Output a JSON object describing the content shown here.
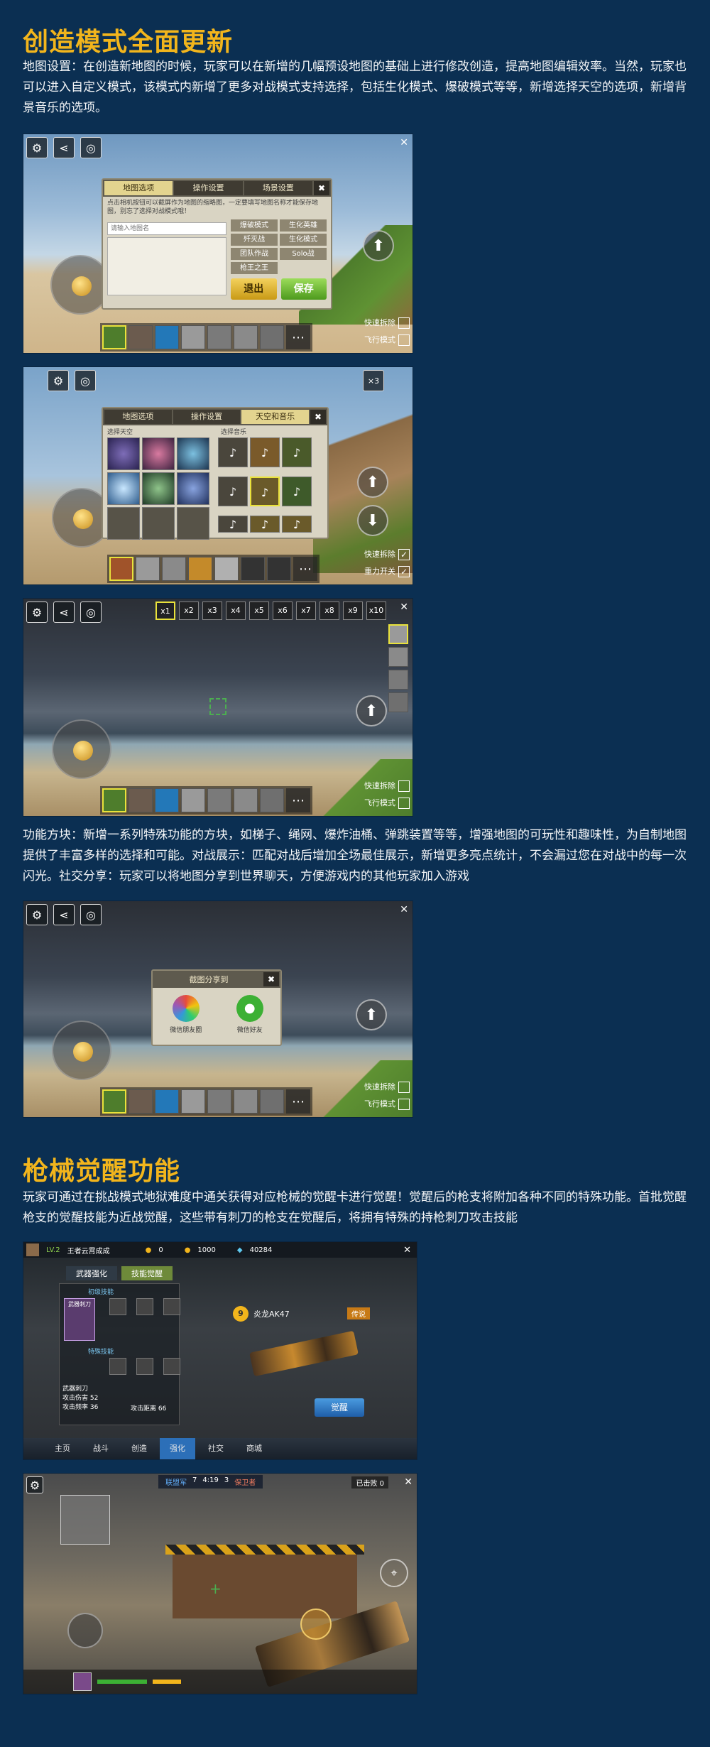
{
  "section1": {
    "title": "创造模式全面更新",
    "para1": "地图设置：在创造新地图的时候，玩家可以在新增的几幅预设地图的基础上进行修改创造，提高地图编辑效率。当然，玩家也可以进入自定义模式，该模式内新增了更多对战模式支持选择，包括生化模式、爆破模式等等，新增选择天空的选项，新增背景音乐的选项。",
    "para2": "功能方块：新增一系列特殊功能的方块，如梯子、绳网、爆炸油桶、弹跳装置等等，增强地图的可玩性和趣味性，为自制地图提供了丰富多样的选择和可能。对战展示：匹配对战后增加全场最佳展示，新增更多亮点统计，不会漏过您在对战中的每一次闪光。社交分享：玩家可以将地图分享到世界聊天，方便游戏内的其他玩家加入游戏"
  },
  "shot1": {
    "tabs": [
      "地图选项",
      "操作设置",
      "场景设置"
    ],
    "close": "✖",
    "hint": "点击相机按钮可以截屏作为地图的缩略图，一定要填写地图名称才能保存地图，别忘了选择对战模式哦！",
    "input_placeholder": "请输入地图名",
    "modes": [
      "爆破模式",
      "生化英雄",
      "歼灭战",
      "生化模式",
      "团队作战",
      "Solo战",
      "枪王之王"
    ],
    "exit": "退出",
    "save": "保存",
    "toggle1": "快速拆除",
    "toggle2": "飞行模式"
  },
  "shot2": {
    "tabs": [
      "地图选项",
      "操作设置",
      "天空和音乐"
    ],
    "sky_label": "选择天空",
    "music_label": "选择音乐",
    "counter": "×3",
    "toggle1": "快速拆除",
    "toggle2": "重力开关",
    "check": "✓"
  },
  "shot3": {
    "zooms": [
      "x1",
      "x2",
      "x3",
      "x4",
      "x5",
      "x6",
      "x7",
      "x8",
      "x9",
      "x10"
    ],
    "toggle1": "快速拆除",
    "toggle2": "飞行模式"
  },
  "shot4": {
    "dialog_title": "截图分享到",
    "share1": "微信朋友圈",
    "share2": "微信好友",
    "toggle1": "快速拆除",
    "toggle2": "飞行模式"
  },
  "section2": {
    "title": "枪械觉醒功能",
    "para": "玩家可通过在挑战模式地狱难度中通关获得对应枪械的觉醒卡进行觉醒！觉醒后的枪支将附加各种不同的特殊功能。首批觉醒枪支的觉醒技能为近战觉醒，这些带有刺刀的枪支在觉醒后，将拥有特殊的持枪刺刀攻击技能"
  },
  "shot5": {
    "level": "LV.2",
    "player": "王者云霄成成",
    "coin1": "0",
    "coin2": "1000",
    "diamonds": "40284",
    "tab_a": "武器强化",
    "tab_b": "技能觉醒",
    "sec_a": "初级技能",
    "sec_b": "特殊技能",
    "skill_name": "武器刺刀",
    "gun_name": "炎龙AK47",
    "level_num": "9",
    "tag": "传说",
    "stat_label": "武器刺刀",
    "stat1": "攻击伤害 52",
    "stat2": "攻击频率 36",
    "stat3": "攻击距离 66",
    "awaken_btn": "觉醒",
    "nav": [
      "主页",
      "战斗",
      "创造",
      "强化",
      "社交",
      "商城"
    ]
  },
  "shot6": {
    "team_a": "联盟军",
    "score_a": "7",
    "timer": "4:19",
    "score_b": "3",
    "team_b": "保卫者",
    "kills": "已击败 0"
  }
}
